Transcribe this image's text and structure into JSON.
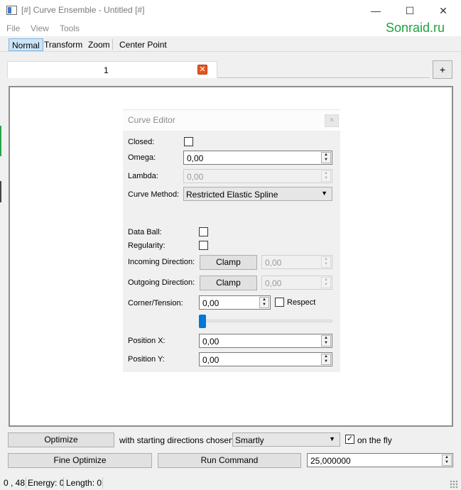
{
  "window": {
    "title": "[#] Curve Ensemble - Untitled [#]",
    "minimize_glyph": "—",
    "maximize_glyph": "☐",
    "close_glyph": "✕"
  },
  "menu": {
    "file": "File",
    "view": "View",
    "tools": "Tools"
  },
  "watermark": "Sonraid.ru",
  "modes": {
    "normal": "Normal",
    "transform": "Transform",
    "zoom": "Zoom",
    "center_point": "Center Point"
  },
  "tabs": {
    "active_label": "1",
    "close_glyph": "✕",
    "add_glyph": "+"
  },
  "editor": {
    "title": "Curve Editor",
    "close_glyph": "×",
    "closed_label": "Closed:",
    "omega_label": "Omega:",
    "omega_value": "0,00",
    "lambda_label": "Lambda:",
    "lambda_value": "0,00",
    "curve_method_label": "Curve Method:",
    "curve_method_value": "Restricted Elastic Spline",
    "data_ball_label": "Data Ball:",
    "regularity_label": "Regularity:",
    "incoming_label": "Incoming Direction:",
    "incoming_button": "Clamp",
    "incoming_value": "0,00",
    "outgoing_label": "Outgoing Direction:",
    "outgoing_button": "Clamp",
    "outgoing_value": "0,00",
    "corner_label": "Corner/Tension:",
    "corner_value": "0,00",
    "respect_label": "Respect",
    "position_x_label": "Position X:",
    "position_x_value": "0,00",
    "position_y_label": "Position Y:",
    "position_y_value": "0,00",
    "tension_slider_level": 0
  },
  "bottom": {
    "optimize": "Optimize",
    "starting_text": "with starting directions chosen",
    "directions_value": "Smartly",
    "on_the_fly_label": "on the fly",
    "on_the_fly_checked": "✓",
    "fine_optimize": "Fine Optimize",
    "run_command": "Run Command",
    "command_value": "25,000000"
  },
  "status": {
    "coords": "0 , 48",
    "energy": "Energy: 0",
    "length": "Length: 0"
  },
  "colors": {
    "accent": "#0078d7",
    "brand": "#1fa33f",
    "tab_close": "#e8541f"
  }
}
